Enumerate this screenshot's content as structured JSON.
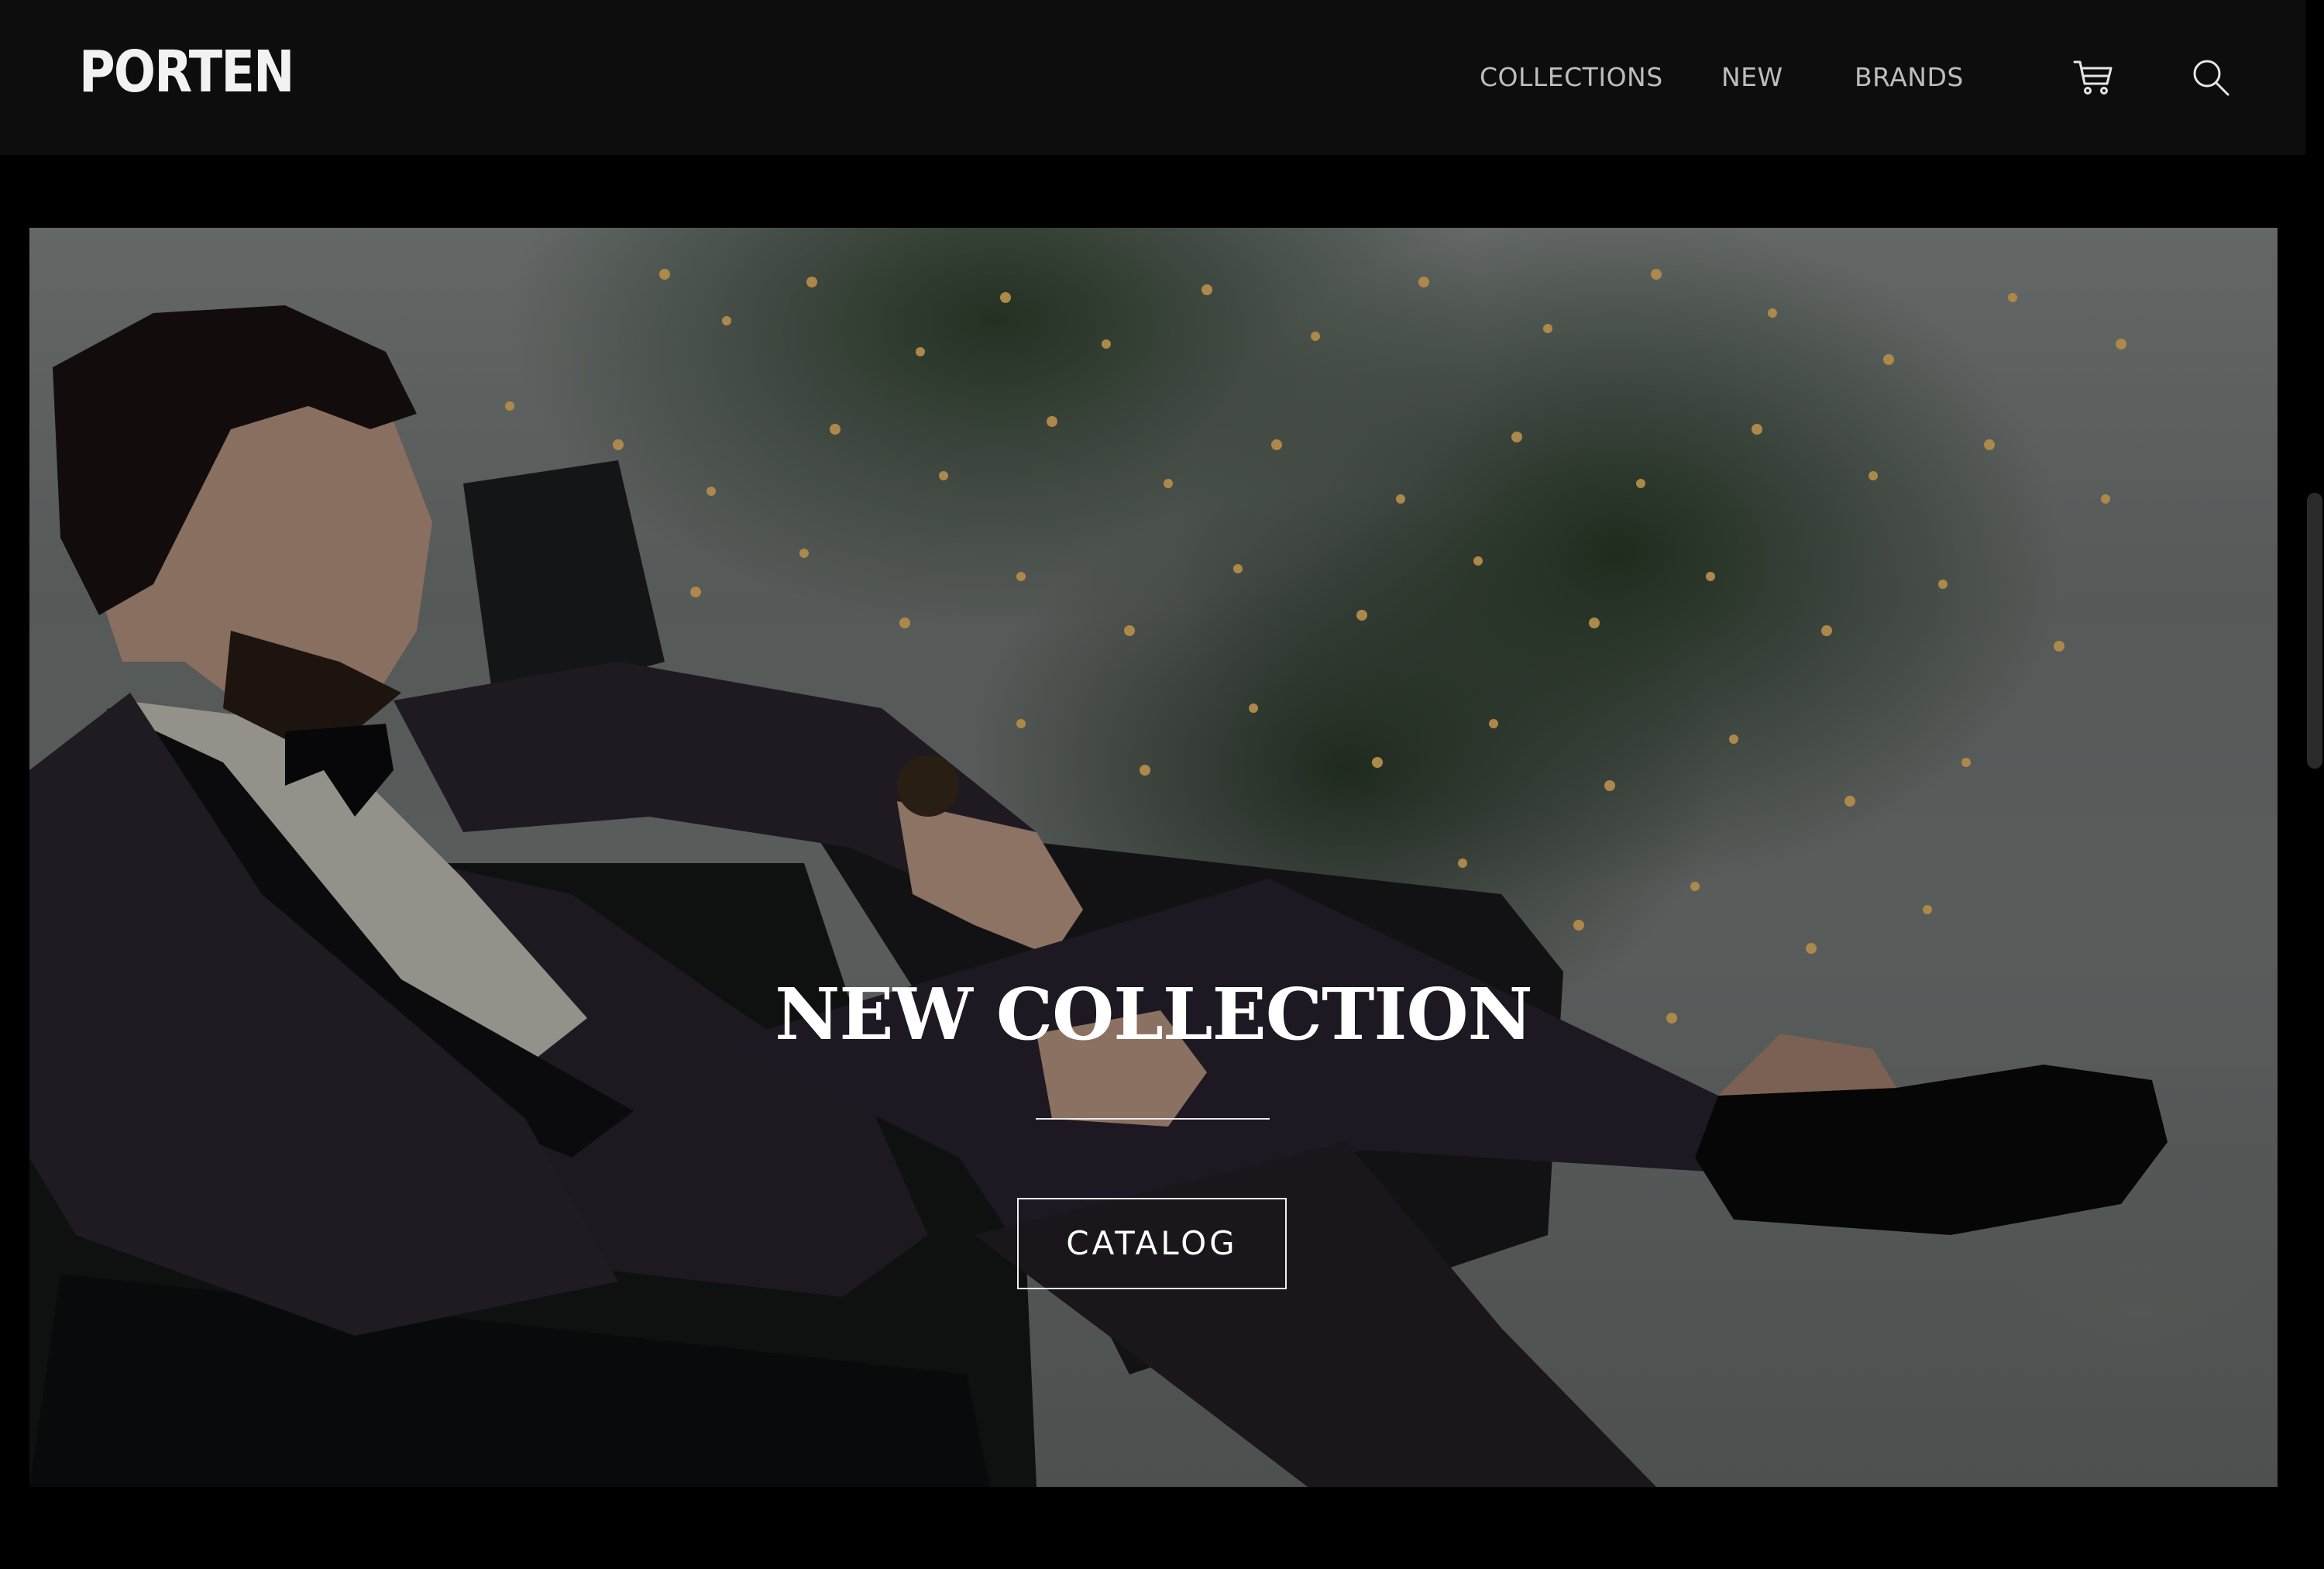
{
  "header": {
    "logo": "PORTEN",
    "nav": {
      "collections": "COLLECTIONS",
      "new": "NEW",
      "brands": "BRANDS"
    },
    "icons": {
      "cart": "cart-icon",
      "search": "search-icon"
    }
  },
  "hero": {
    "title": "NEW COLLECTION",
    "button_label": "CATALOG",
    "image": "man-in-tuxedo-armchair-christmas-tree"
  },
  "colors": {
    "header_bg": "#0d0d0d",
    "page_bg": "#000000",
    "text": "#ffffff",
    "nav_text": "#bdbdbd"
  }
}
